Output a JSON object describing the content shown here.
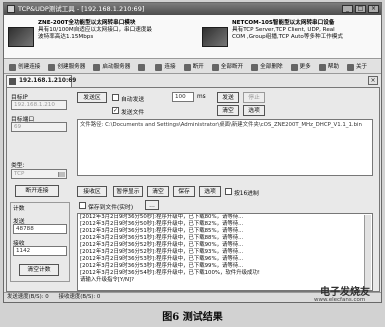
{
  "window": {
    "title": "TCP&UDP测试工具 - [192.168.1.210:69]"
  },
  "banner": {
    "left": {
      "title": "ZNE-200T全功能型以太网转串口模块",
      "line2": "具有10/100M自适应以太网接口，串口速度最",
      "line3": "波特率高达1.15Mbps"
    },
    "right": {
      "title": "NETCOM-10S智能型以太网转串口设备",
      "line2": "具有TCP Server,TCP Client, UDP, Real",
      "line3": "COM ,Group组播,TCP Auto等多种工作模式"
    }
  },
  "toolbar": {
    "buttons": [
      "创建连接",
      "创建服务器",
      "启动服务器",
      "",
      "连接",
      "断开",
      "全部断开",
      "全部删除",
      "更多",
      "帮助",
      "关于"
    ]
  },
  "connection_tab": {
    "label": "192.168.1.210:69",
    "close": "×"
  },
  "left_panel": {
    "target_ip_label": "目标IP",
    "target_ip_value": "192.168.1.210",
    "target_port_label": "目标端口",
    "target_port_value": "69",
    "type_label": "类型:",
    "type_value": "TCP",
    "connect_button": "断开连接",
    "count_label": "计数",
    "sent_label": "发送",
    "sent_value": "48788",
    "received_label": "接收",
    "received_value": "1142",
    "clear_count_button": "清空计数"
  },
  "send_section": {
    "send_area_button": "发送区",
    "auto_send_label": "自动发送",
    "interval_value": "100",
    "interval_unit": "ms",
    "send_button": "发送",
    "stop_button": "停止",
    "send_file_label": "发送文件",
    "clear_button": "清空",
    "options_button": "选项",
    "file_path": "文件路径: C:\\Documents and Settings\\Administrator\\桌面\\新建文件夹\\cOS_ZNE200T_MHz_DHCP_V1.1_1.bin"
  },
  "receive_section": {
    "recv_area_button": "接收区",
    "pause_display_button": "暂停显示",
    "clear_button": "清空",
    "save_button": "保存",
    "options_button": "选项",
    "hex_label": "按16进制",
    "save_to_file_label": "保存到文件(实时)",
    "lines": [
      "[2012年3月2日9时36分50秒]:程序升级中，已下载80%，请等待...",
      "[2012年3月2日9时36分50秒]:程序升级中，已下载82%，请等待...",
      "[2012年3月2日9时36分51秒]:程序升级中，已下载85%，请等待...",
      "[2012年3月2日9时36分51秒]:程序升级中，已下载88%，请等待...",
      "[2012年3月2日9时36分52秒]:程序升级中，已下载90%，请等待...",
      "[2012年3月2日9时36分52秒]:程序升级中，已下载93%，请等待...",
      "[2012年3月2日9时36分53秒]:程序升级中，已下载96%，请等待...",
      "[2012年3月2日9时36分53秒]:程序升级中，已下载99%，请等待...",
      "[2012年3月2日9时36分54秒]:程序升级中，已下载100%，软件升级成功!",
      "请输入升级指令[Y/N]?"
    ]
  },
  "status_bar": {
    "send_speed": "发送速度(B/S): 0",
    "recv_speed": "接收速度(B/S): 0"
  },
  "caption": "图6   测试结果",
  "watermark": {
    "text": "电子发烧友",
    "url": "www.elecfans.com"
  }
}
